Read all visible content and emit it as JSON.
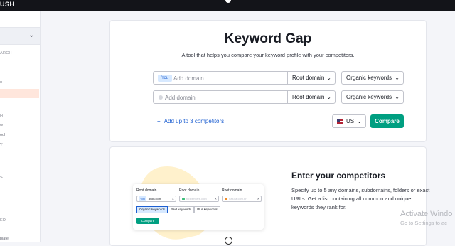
{
  "topbar": {
    "logo_text": "USH"
  },
  "sidebar": {
    "labels": [
      "ARCH",
      "o",
      "H",
      "w",
      "ool",
      "Y",
      "S",
      "ED",
      "plate"
    ]
  },
  "card1": {
    "title": "Keyword Gap",
    "subtitle": "A tool that helps you compare your keyword profile with your competitors.",
    "row1": {
      "badge": "You",
      "placeholder": "Add domain",
      "root_select": "Root domain",
      "type_select": "Organic keywords"
    },
    "row2": {
      "placeholder": "Add domain",
      "root_select": "Root domain",
      "type_select": "Organic keywords"
    },
    "add_more": "Add up to 3 competitors",
    "database": "US",
    "compare": "Compare"
  },
  "card2": {
    "title": "Enter your competitors",
    "description": "Specify up to 5 any domains, subdomains, folders or exact URLs. Get a list containing all common and unique keywords they rank for.",
    "mini": {
      "labels": [
        "Root domain",
        "Root domain",
        "Root domain"
      ],
      "field1_badge": "You",
      "field1_text": "avon.com",
      "field2_placeholder": "tupperware.com",
      "field3_placeholder": "natura.com.br",
      "dot_colors": [
        "#3dbd79",
        "#f18c28"
      ],
      "tabs": [
        "Organic keywords",
        "Paid keywords",
        "PLA keywords"
      ],
      "button": "Compare"
    }
  },
  "watermark": {
    "line1": "Activate Windo",
    "line2": "Go to Settings to ac"
  },
  "colors": {
    "accent": "#009f81",
    "link": "#1d5fd1",
    "topbar": "#131419"
  }
}
